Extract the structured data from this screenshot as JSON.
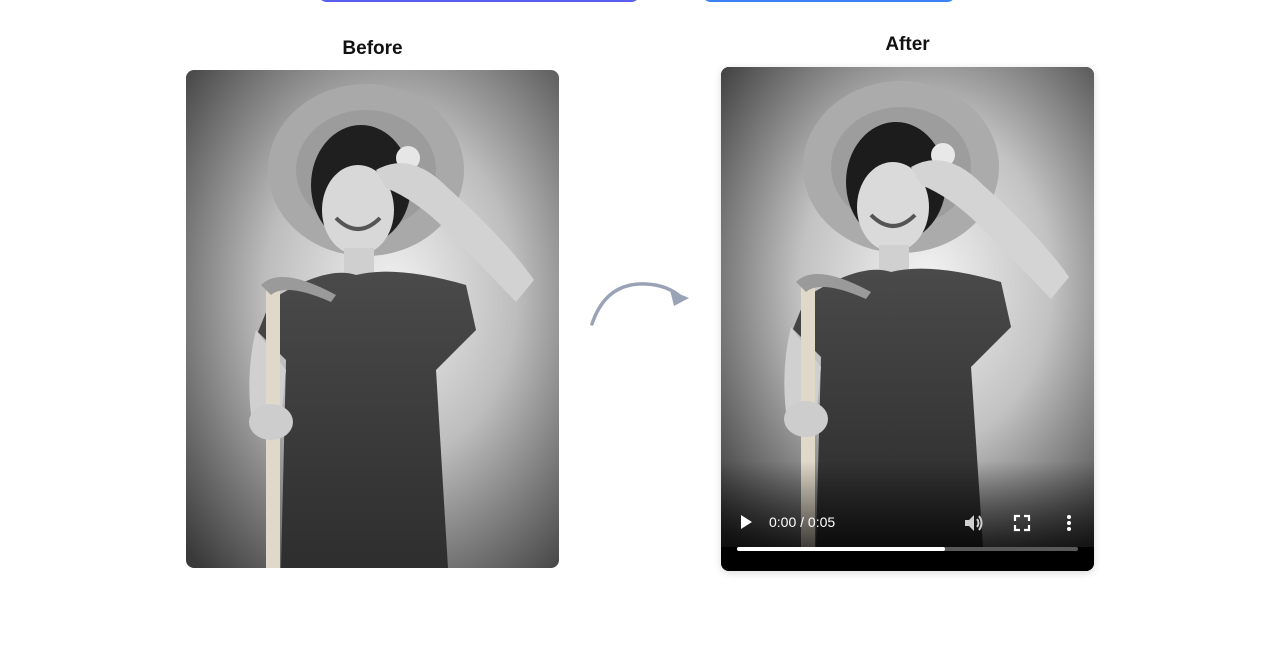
{
  "labels": {
    "before": "Before",
    "after": "After"
  },
  "video_player": {
    "time": "0:00 / 0:05",
    "progress": 0.61
  },
  "icons": {
    "play": "play-icon",
    "volume": "volume-icon",
    "fullscreen": "fullscreen-icon",
    "more": "more-vertical-icon",
    "arrow": "curved-arrow-icon"
  },
  "colors": {
    "top_button_left": "#5b5cf0",
    "top_button_right": "#3b82f6",
    "arrow": "#9aa3b5"
  }
}
